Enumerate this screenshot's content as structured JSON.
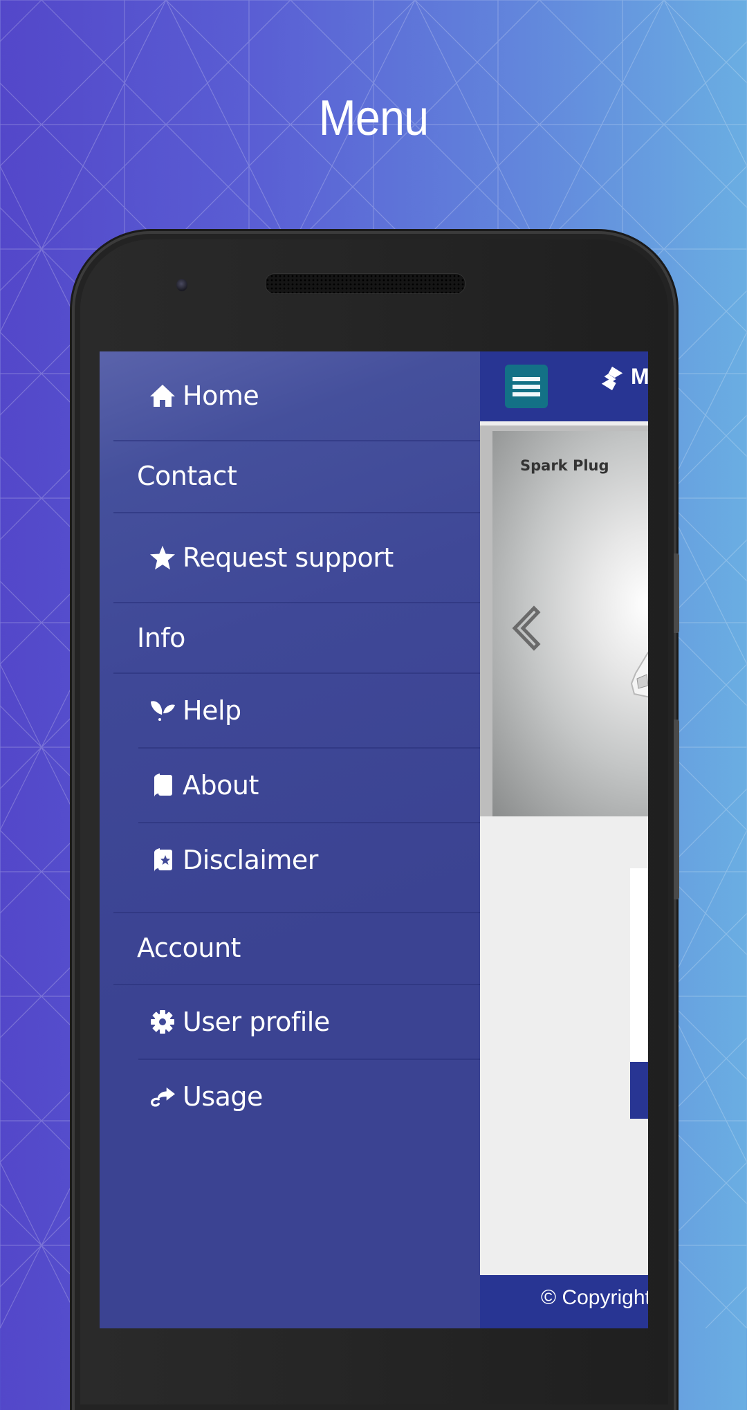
{
  "promo": {
    "title": "Menu"
  },
  "drawer": {
    "items": [
      {
        "type": "item",
        "label": "Home",
        "icon": "home-icon"
      },
      {
        "type": "header",
        "label": "Contact"
      },
      {
        "type": "item",
        "label": "Request support",
        "icon": "star-icon"
      },
      {
        "type": "header",
        "label": "Info"
      },
      {
        "type": "item",
        "label": "Help",
        "icon": "sprout-icon"
      },
      {
        "type": "item",
        "label": "About",
        "icon": "book-icon"
      },
      {
        "type": "item",
        "label": "Disclaimer",
        "icon": "book-star-icon"
      },
      {
        "type": "header",
        "label": "Account"
      },
      {
        "type": "item",
        "label": "User profile",
        "icon": "gear-icon"
      },
      {
        "type": "item",
        "label": "Usage",
        "icon": "share-icon"
      }
    ]
  },
  "app": {
    "brand_text": "M",
    "hero_title": "Spark Plug",
    "footer_text": "© Copyright",
    "colors": {
      "header": "#283593",
      "menu_button": "#137186",
      "drawer": "#3b4392",
      "content_bg": "#eeeeee"
    }
  }
}
